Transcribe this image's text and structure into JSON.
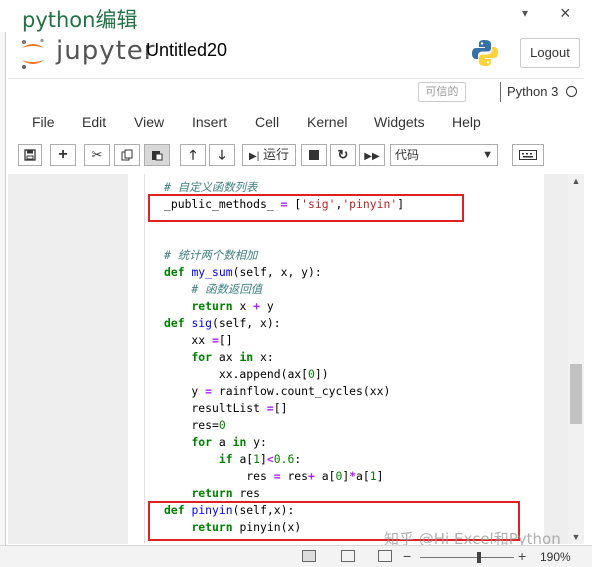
{
  "pane": {
    "title": "python编辑",
    "dropdown_icon": "▾",
    "close_icon": "×"
  },
  "jupyter": {
    "logo_text": "jupyter",
    "notebook_name": "Untitled20",
    "logout_label": "Logout",
    "trusted_label": "可信的",
    "kernel_name": "Python 3"
  },
  "menu": {
    "items": [
      "File",
      "Edit",
      "View",
      "Insert",
      "Cell",
      "Kernel",
      "Widgets",
      "Help"
    ]
  },
  "toolbar": {
    "save_icon": "save-icon",
    "add_label": "+",
    "run_label": "运行",
    "cell_type": "代码"
  },
  "code": {
    "lines": [
      "# 自定义函数列表",
      "_public_methods_ = ['sig','pinyin']",
      "",
      "",
      "# 统计两个数相加",
      "def my_sum(self, x, y):",
      "    # 函数返回值",
      "    return x + y",
      "def sig(self, x):",
      "    xx =[]",
      "    for ax in x:",
      "        xx.append(ax[0])",
      "    y = rainflow.count_cycles(xx)",
      "    resultList =[]",
      "    res=0",
      "    for a in y:",
      "        if a[1]<0.6:",
      "            res = res+ a[0]*a[1]",
      "    return res",
      "def pinyin(self,x):",
      "    return pinyin(x)"
    ]
  },
  "status": {
    "zoom": "190%"
  },
  "watermark": "知乎 @Hi Excel和Python",
  "colors": {
    "accent": "#217346",
    "highlight_box": "#e02020",
    "python_blue": "#3572a5",
    "python_yellow": "#ffd43b",
    "jupyter_orange": "#f37626"
  }
}
